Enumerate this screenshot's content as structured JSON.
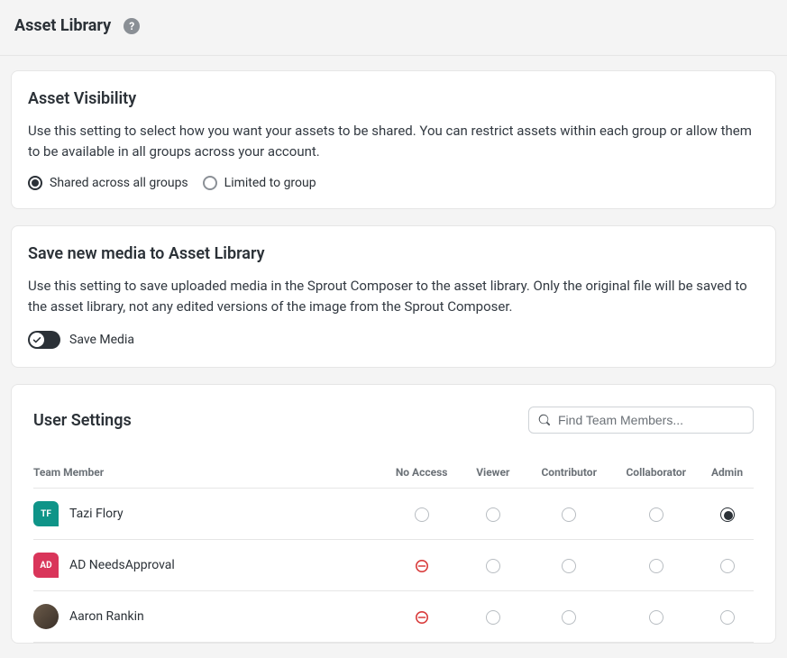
{
  "header": {
    "title": "Asset Library"
  },
  "visibility": {
    "title": "Asset Visibility",
    "description": "Use this setting to select how you want your assets to be shared. You can restrict assets within each group or allow them to be available in all groups across your account.",
    "options": [
      {
        "label": "Shared across all groups",
        "selected": true
      },
      {
        "label": "Limited to group",
        "selected": false
      }
    ]
  },
  "saveMedia": {
    "title": "Save new media to Asset Library",
    "description": "Use this setting to save uploaded media in the Sprout Composer to the asset library. Only the original file will be saved to the asset library, not any edited versions of the image from the Sprout Composer.",
    "toggle_label": "Save Media",
    "toggle_on": true
  },
  "userSettings": {
    "title": "User Settings",
    "search_placeholder": "Find Team Members...",
    "columns": {
      "member": "Team Member",
      "noaccess": "No Access",
      "viewer": "Viewer",
      "contributor": "Contributor",
      "collaborator": "Collaborator",
      "admin": "Admin"
    },
    "rows": [
      {
        "name": "Tazi Flory",
        "initials": "TF",
        "avatar_bg": "#0f9488",
        "avatar_type": "initials",
        "noaccess_state": "radio",
        "access": "admin"
      },
      {
        "name": "AD NeedsApproval",
        "initials": "AD",
        "avatar_bg": "#d9355a",
        "avatar_type": "initials",
        "noaccess_state": "blocked",
        "access": ""
      },
      {
        "name": "Aaron Rankin",
        "initials": "",
        "avatar_bg": "#555",
        "avatar_type": "photo",
        "noaccess_state": "blocked",
        "access": ""
      }
    ]
  }
}
